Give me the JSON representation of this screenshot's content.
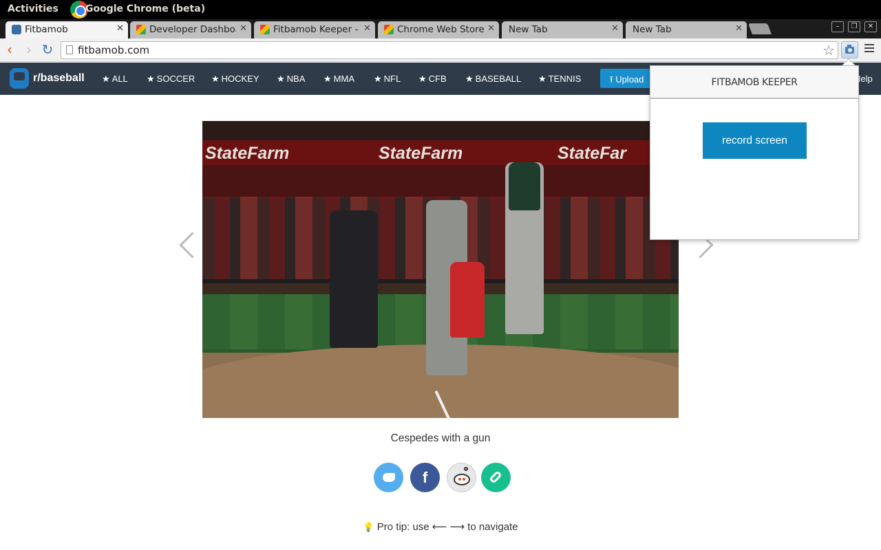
{
  "os_panel": {
    "activities": "Activities",
    "app_name": "Google Chrome (beta)"
  },
  "browser": {
    "tabs": [
      {
        "label": "Fitbamob",
        "favicon": "fitbamob-icon",
        "active": true
      },
      {
        "label": "Developer Dashboard",
        "favicon": "chrome-store-icon",
        "active": false
      },
      {
        "label": "Fitbamob Keeper - Edi",
        "favicon": "chrome-store-icon",
        "active": false
      },
      {
        "label": "Chrome Web Store - fi",
        "favicon": "chrome-store-icon",
        "active": false
      },
      {
        "label": "New Tab",
        "favicon": "",
        "active": false
      },
      {
        "label": "New Tab",
        "favicon": "",
        "active": false
      }
    ],
    "url": "fitbamob.com",
    "window_controls": [
      "minimize",
      "maximize",
      "close"
    ]
  },
  "site": {
    "brand": "r/baseball",
    "nav": [
      {
        "label": "ALL"
      },
      {
        "label": "SOCCER"
      },
      {
        "label": "HOCKEY"
      },
      {
        "label": "NBA"
      },
      {
        "label": "MMA"
      },
      {
        "label": "NFL"
      },
      {
        "label": "CFB"
      },
      {
        "label": "BASEBALL"
      },
      {
        "label": "TENNIS"
      }
    ],
    "upload_label": "Upload",
    "help_label": "Help",
    "caption": "Cespedes with a gun",
    "share": [
      "twitter",
      "facebook",
      "reddit",
      "link"
    ],
    "protip": "Pro tip: use ⟵ ⟶ to navigate",
    "media_banner_text": [
      "StateFarm",
      "StateFarm",
      "StateFar"
    ]
  },
  "popup": {
    "title": "FITBAMOB KEEPER",
    "record_button": "record screen"
  },
  "colors": {
    "site_nav_bg": "#2f3b48",
    "accent_blue": "#0e87c0",
    "twitter": "#55acee",
    "facebook": "#3b5998",
    "link_green": "#19c08f"
  }
}
